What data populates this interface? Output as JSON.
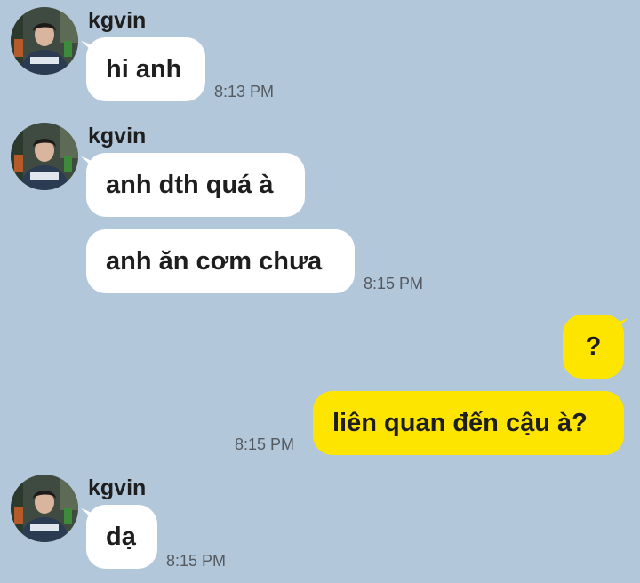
{
  "colors": {
    "background": "#b2c7da",
    "incoming_bubble": "#ffffff",
    "outgoing_bubble": "#fee500",
    "text": "#1e1e1e",
    "timestamp": "#555a60"
  },
  "messages": [
    {
      "direction": "incoming",
      "sender": "kgvin",
      "avatar": "profile-photo-icon",
      "text": "hi anh",
      "time": "8:13 PM"
    },
    {
      "direction": "incoming",
      "sender": "kgvin",
      "avatar": "profile-photo-icon",
      "text": "anh dth quá à",
      "time": ""
    },
    {
      "direction": "incoming",
      "sender": "",
      "text": "anh ăn cơm chưa",
      "time": "8:15 PM"
    },
    {
      "direction": "outgoing",
      "text": "?",
      "time": ""
    },
    {
      "direction": "outgoing",
      "text": "liên quan đến cậu à?",
      "time": "8:15 PM"
    },
    {
      "direction": "incoming",
      "sender": "kgvin",
      "avatar": "profile-photo-icon",
      "text": "dạ",
      "time": "8:15 PM"
    }
  ]
}
